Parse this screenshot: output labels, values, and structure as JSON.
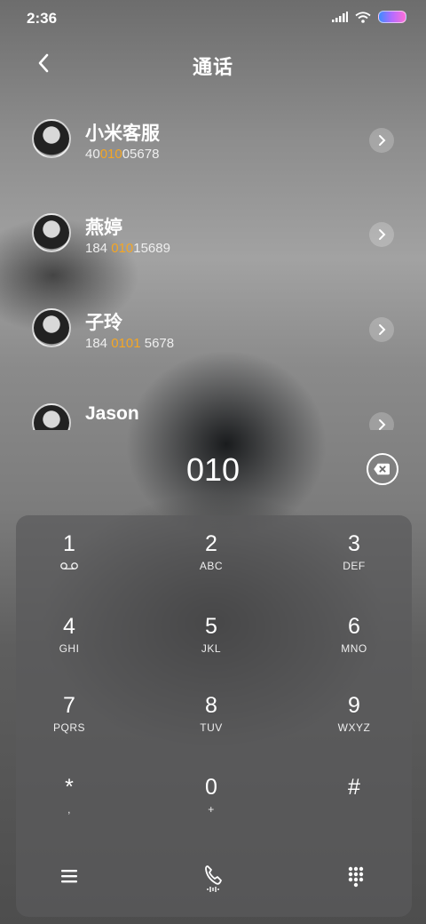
{
  "status_bar": {
    "time": "2:36"
  },
  "header": {
    "title": "通话"
  },
  "contacts": [
    {
      "name": "小米客服",
      "number_prefix": "40",
      "number_match": "010",
      "number_suffix": "05678"
    },
    {
      "name": "燕婷",
      "number_prefix": "184 ",
      "number_match": "010",
      "number_suffix": "15689"
    },
    {
      "name": "子玲",
      "number_prefix": "184 ",
      "number_match": "0101",
      "number_suffix": " 5678"
    },
    {
      "name": "Jason",
      "number_prefix": "",
      "number_match": "",
      "number_suffix": ""
    }
  ],
  "dialer": {
    "input": "010",
    "keys": [
      {
        "digit": "1",
        "letters": ""
      },
      {
        "digit": "2",
        "letters": "ABC"
      },
      {
        "digit": "3",
        "letters": "DEF"
      },
      {
        "digit": "4",
        "letters": "GHI"
      },
      {
        "digit": "5",
        "letters": "JKL"
      },
      {
        "digit": "6",
        "letters": "MNO"
      },
      {
        "digit": "7",
        "letters": "PQRS"
      },
      {
        "digit": "8",
        "letters": "TUV"
      },
      {
        "digit": "9",
        "letters": "WXYZ"
      },
      {
        "digit": "*",
        "letters": ","
      },
      {
        "digit": "0",
        "letters": "+"
      },
      {
        "digit": "#",
        "letters": ""
      }
    ]
  },
  "colors": {
    "match_highlight": "#f5a623"
  },
  "icons": [
    "back-arrow-icon",
    "signal-icon",
    "wifi-icon",
    "battery-icon",
    "chevron-right-icon",
    "backspace-icon",
    "voicemail-icon",
    "menu-icon",
    "phone-call-icon",
    "keypad-icon"
  ]
}
